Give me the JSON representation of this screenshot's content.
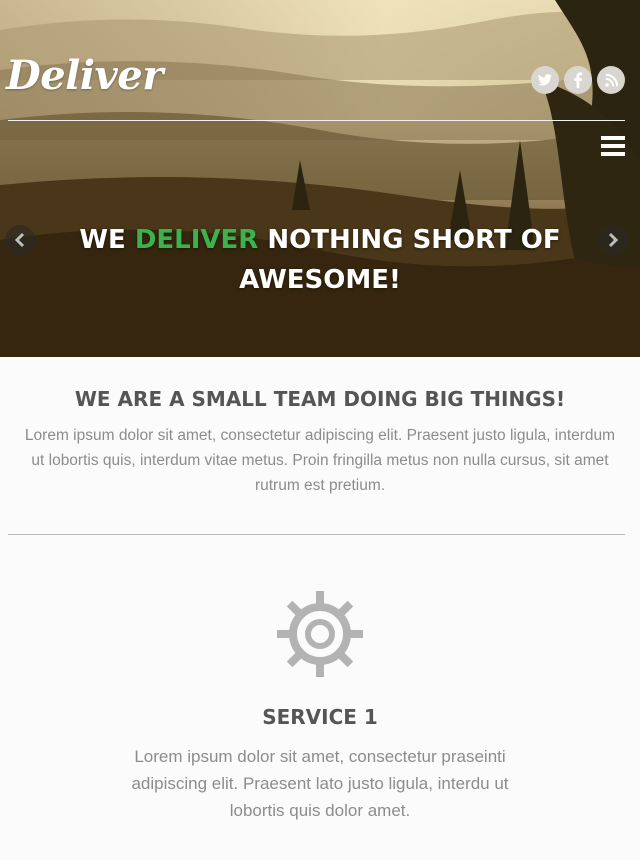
{
  "brand": {
    "logo": "Deliver"
  },
  "social": [
    {
      "icon": "twitter-icon"
    },
    {
      "icon": "facebook-icon"
    },
    {
      "icon": "rss-icon"
    }
  ],
  "hero": {
    "headline_before": "WE ",
    "headline_accent": "DELIVER",
    "headline_after": " NOTHING SHORT OF AWESOME!",
    "accent_color": "#3bb34a"
  },
  "intro": {
    "title": "WE ARE A SMALL TEAM DOING BIG THINGS!",
    "text": "Lorem ipsum dolor sit amet, consectetur adipiscing elit. Praesent justo ligula, interdum ut lobortis quis, interdum vitae metus. Proin fringilla metus non nulla cursus, sit amet rutrum est pretium."
  },
  "service": {
    "icon": "gear-icon",
    "title": "SERVICE 1",
    "text": "Lorem ipsum dolor sit amet, consectetur praseinti adipiscing elit. Praesent lato justo ligula, interdu ut lobortis quis dolor amet."
  }
}
